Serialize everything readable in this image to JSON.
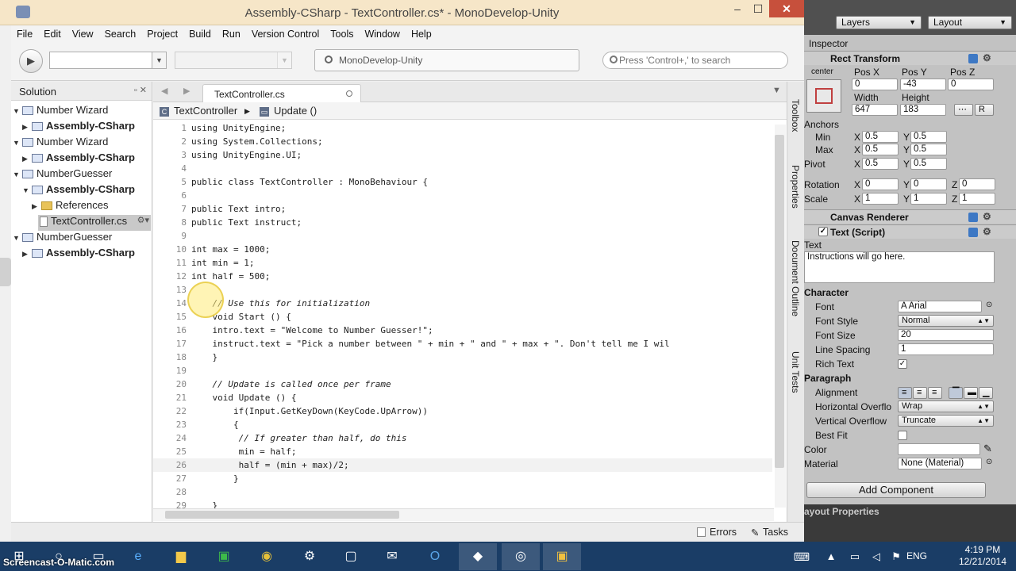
{
  "window": {
    "title": "Assembly-CSharp - TextController.cs* - MonoDevelop-Unity",
    "min": "–",
    "max": "☐",
    "close": "✕"
  },
  "menu": [
    "File",
    "Edit",
    "View",
    "Search",
    "Project",
    "Build",
    "Run",
    "Version Control",
    "Tools",
    "Window",
    "Help"
  ],
  "toolbar": {
    "status": "MonoDevelop-Unity",
    "search_placeholder": "Press 'Control+,' to search"
  },
  "solution": {
    "title": "Solution",
    "nodes": [
      {
        "label": "Number Wizard",
        "kind": "solution",
        "bold": false
      },
      {
        "label": "Assembly-CSharp",
        "kind": "project",
        "bold": true
      },
      {
        "label": "Number Wizard",
        "kind": "solution",
        "bold": false
      },
      {
        "label": "Assembly-CSharp",
        "kind": "project",
        "bold": true
      },
      {
        "label": "NumberGuesser",
        "kind": "solution",
        "bold": false
      },
      {
        "label": "Assembly-CSharp",
        "kind": "project",
        "bold": true
      },
      {
        "label": "References",
        "kind": "folder",
        "bold": false
      },
      {
        "label": "TextController.cs",
        "kind": "file",
        "bold": false
      },
      {
        "label": "NumberGuesser",
        "kind": "solution",
        "bold": false
      },
      {
        "label": "Assembly-CSharp",
        "kind": "project",
        "bold": true
      }
    ]
  },
  "editor": {
    "tab": "TextController.cs",
    "path_class": "TextController",
    "path_method": "Update ()",
    "lines": [
      {
        "n": "1",
        "t": "using UnityEngine;"
      },
      {
        "n": "2",
        "t": "using System.Collections;"
      },
      {
        "n": "3",
        "t": "using UnityEngine.UI;"
      },
      {
        "n": "4",
        "t": ""
      },
      {
        "n": "5",
        "t": "public class TextController : MonoBehaviour {"
      },
      {
        "n": "6",
        "t": ""
      },
      {
        "n": "7",
        "t": "public Text intro;"
      },
      {
        "n": "8",
        "t": "public Text instruct;"
      },
      {
        "n": "9",
        "t": ""
      },
      {
        "n": "10",
        "t": "int max = 1000;"
      },
      {
        "n": "11",
        "t": "int min = 1;"
      },
      {
        "n": "12",
        "t": "int half = 500;"
      },
      {
        "n": "13",
        "t": ""
      },
      {
        "n": "14",
        "t": "    // Use this for initialization"
      },
      {
        "n": "15",
        "t": "    void Start () {"
      },
      {
        "n": "16",
        "t": "    intro.text = \"Welcome to Number Guesser!\";"
      },
      {
        "n": "17",
        "t": "    instruct.text = \"Pick a number between \" + min + \" and \" + max + \". Don't tell me I wil"
      },
      {
        "n": "18",
        "t": "    }"
      },
      {
        "n": "19",
        "t": ""
      },
      {
        "n": "20",
        "t": "    // Update is called once per frame"
      },
      {
        "n": "21",
        "t": "    void Update () {"
      },
      {
        "n": "22",
        "t": "        if(Input.GetKeyDown(KeyCode.UpArrow))"
      },
      {
        "n": "23",
        "t": "        {"
      },
      {
        "n": "24",
        "t": "         // If greater than half, do this"
      },
      {
        "n": "25",
        "t": "         min = half;"
      },
      {
        "n": "26",
        "t": "         half = (min + max)/2;"
      },
      {
        "n": "27",
        "t": "        }"
      },
      {
        "n": "28",
        "t": ""
      },
      {
        "n": "29",
        "t": "    }"
      }
    ]
  },
  "right_pads": [
    "Toolbox",
    "Properties",
    "Document Outline",
    "Unit Tests"
  ],
  "statusbar": {
    "errors": "Errors",
    "tasks": "Tasks"
  },
  "unity": {
    "layers": "Layers",
    "layout": "Layout",
    "inspector_tab": "Inspector",
    "rect_transform": "Rect Transform",
    "anchor_label": "center",
    "posx_label": "Pos X",
    "posy_label": "Pos Y",
    "posz_label": "Pos Z",
    "posx": "0",
    "posy": "-43",
    "posz": "0",
    "width_label": "Width",
    "height_label": "Height",
    "width": "647",
    "height": "183",
    "r_button": "R",
    "anchors": "Anchors",
    "min": "Min",
    "max": "Max",
    "pivot": "Pivot",
    "x": "X",
    "y": "Y",
    "z": "Z",
    "min_x": "0.5",
    "min_y": "0.5",
    "max_x": "0.5",
    "max_y": "0.5",
    "pivot_x": "0.5",
    "pivot_y": "0.5",
    "rotation": "Rotation",
    "scale": "Scale",
    "rot_x": "0",
    "rot_y": "0",
    "rot_z": "0",
    "scale_x": "1",
    "scale_y": "1",
    "scale_z": "1",
    "canvas_renderer": "Canvas Renderer",
    "text_script": "Text (Script)",
    "text_label": "Text",
    "text_value": "Instructions will go here.",
    "character": "Character",
    "font_label": "Font",
    "font": "Arial",
    "font_style_label": "Font Style",
    "font_style": "Normal",
    "font_size_label": "Font Size",
    "font_size": "20",
    "line_spacing_label": "Line Spacing",
    "line_spacing": "1",
    "rich_text_label": "Rich Text",
    "paragraph": "Paragraph",
    "alignment_label": "Alignment",
    "h_overflow_label": "Horizontal Overflo",
    "h_overflow": "Wrap",
    "v_overflow_label": "Vertical Overflow",
    "v_overflow": "Truncate",
    "best_fit_label": "Best Fit",
    "color_label": "Color",
    "material_label": "Material",
    "material": "None (Material)",
    "add_component": "Add Component",
    "layout_properties": "ayout Properties"
  },
  "taskbar": {
    "watermark": "Screencast-O-Matic.com",
    "lang": "ENG",
    "time": "4:19 PM",
    "date": "12/21/2014"
  }
}
